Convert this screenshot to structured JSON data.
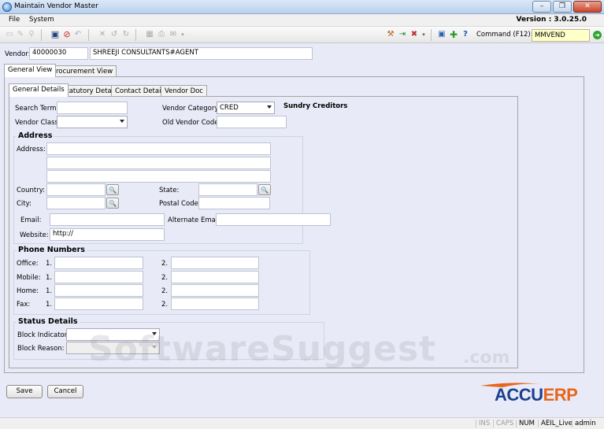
{
  "window": {
    "title": "Maintain Vendor Master",
    "controls": {
      "minimize": "–",
      "restore": "❐",
      "close": "✕"
    }
  },
  "menu": {
    "items": [
      "File",
      "System"
    ],
    "version": "Version : 3.0.25.0"
  },
  "toolbar": {
    "command_label": "Command (F12):",
    "command_value": "MMVEND"
  },
  "vendor": {
    "label": "Vendor:",
    "code": "40000030",
    "name": "SHREEJI CONSULTANTS#AGENT"
  },
  "outer_tabs": [
    "General View",
    "Procurement View"
  ],
  "inner_tabs": [
    "General Details",
    "Statutory Details",
    "Contact Details",
    "Vendor Doc"
  ],
  "general": {
    "search_term_label": "Search Term:",
    "search_term": "",
    "vendor_class_label": "Vendor Class:",
    "vendor_class": "",
    "vendor_category_label": "Vendor Category:",
    "vendor_category": "CRED",
    "vendor_category_desc": "Sundry Creditors",
    "old_vendor_code_label": "Old Vendor Code:",
    "old_vendor_code": ""
  },
  "address": {
    "title": "Address",
    "address_label": "Address:",
    "lines": [
      "",
      "",
      ""
    ],
    "country_label": "Country:",
    "country": "",
    "state_label": "State:",
    "state": "",
    "city_label": "City:",
    "city": "",
    "postal_code_label": "Postal Code:",
    "postal_code": "",
    "email_label": "Email:",
    "email": "",
    "alt_email_label": "Alternate Email:",
    "alt_email": "",
    "website_label": "Website:",
    "website": "http://"
  },
  "phone": {
    "title": "Phone Numbers",
    "rows": [
      {
        "label": "Office:",
        "n1": "1.",
        "n2": "2."
      },
      {
        "label": "Mobile:",
        "n1": "1.",
        "n2": "2."
      },
      {
        "label": "Home:",
        "n1": "1.",
        "n2": "2."
      },
      {
        "label": "Fax:",
        "n1": "1.",
        "n2": "2."
      }
    ]
  },
  "status": {
    "title": "Status Details",
    "block_indicator_label": "Block Indicator:",
    "block_indicator": "",
    "block_reason_label": "Block Reason:",
    "block_reason": ""
  },
  "buttons": {
    "save": "Save",
    "cancel": "Cancel"
  },
  "watermark": {
    "text": "SoftwareSuggest",
    "suffix": ".com"
  },
  "logo": {
    "accu": "ACCU",
    "erp": "ERP",
    "accu_color": "#1b3f8f",
    "erp_color": "#e8651a"
  },
  "statusbar": [
    "INS",
    "CAPS",
    "NUM",
    "AEIL_Live",
    "admin"
  ]
}
